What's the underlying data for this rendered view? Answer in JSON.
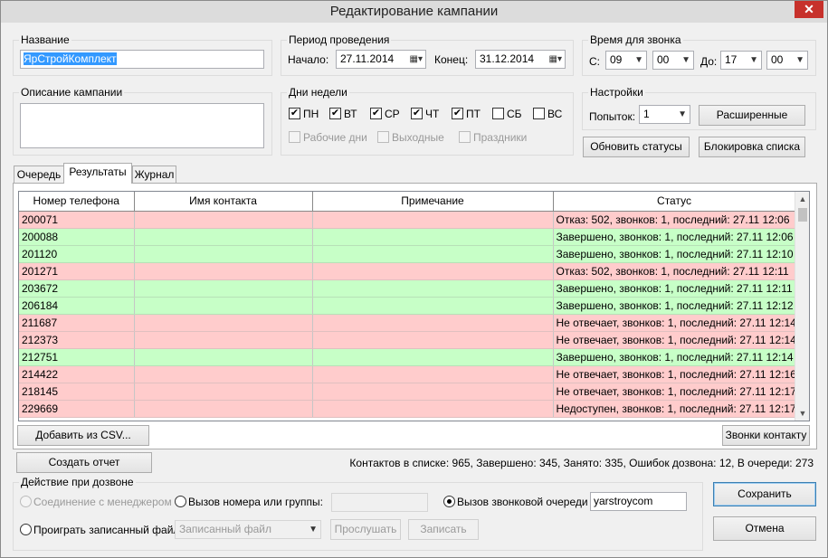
{
  "window": {
    "title": "Редактирование кампании",
    "close_glyph": "✕"
  },
  "name_group": {
    "label": "Название",
    "value": "ЯрСтройКомплект"
  },
  "desc_group": {
    "label": "Описание кампании",
    "value": ""
  },
  "period": {
    "label": "Период проведения",
    "start_label": "Начало:",
    "start_value": "27.11.2014",
    "end_label": "Конец:",
    "end_value": "31.12.2014"
  },
  "call_time": {
    "label": "Время для звонка",
    "from_label": "С:",
    "from_hour": "09",
    "from_min": "00",
    "to_label": "До:",
    "to_hour": "17",
    "to_min": "00"
  },
  "weekdays": {
    "label": "Дни недели",
    "days": [
      {
        "label": "ПН",
        "checked": true
      },
      {
        "label": "ВТ",
        "checked": true
      },
      {
        "label": "СР",
        "checked": true
      },
      {
        "label": "ЧТ",
        "checked": true
      },
      {
        "label": "ПТ",
        "checked": true
      },
      {
        "label": "СБ",
        "checked": false
      },
      {
        "label": "ВС",
        "checked": false
      }
    ],
    "workdays_label": "Рабочие дни",
    "weekends_label": "Выходные",
    "holidays_label": "Праздники"
  },
  "settings": {
    "label": "Настройки",
    "attempts_label": "Попыток:",
    "attempts_value": "1",
    "advanced_button": "Расширенные"
  },
  "buttons": {
    "update_statuses": "Обновить статусы",
    "block_list": "Блокировка списка",
    "add_csv": "Добавить из CSV...",
    "contact_calls": "Звонки контакту",
    "create_report": "Создать отчет",
    "save": "Сохранить",
    "cancel": "Отмена"
  },
  "tabs": [
    {
      "label": "Очередь",
      "active": false
    },
    {
      "label": "Результаты",
      "active": true
    },
    {
      "label": "Журнал",
      "active": false
    }
  ],
  "results_table": {
    "columns": [
      "Номер телефона",
      "Имя контакта",
      "Примечание",
      "Статус"
    ],
    "rows": [
      {
        "phone": "200071",
        "name": "",
        "note": "",
        "status": "Отказ: 502, звонков: 1, последний: 27.11 12:06",
        "state": "fail"
      },
      {
        "phone": "200088",
        "name": "",
        "note": "",
        "status": "Завершено, звонков: 1, последний: 27.11 12:06",
        "state": "ok"
      },
      {
        "phone": "201120",
        "name": "",
        "note": "",
        "status": "Завершено, звонков: 1, последний: 27.11 12:10",
        "state": "ok"
      },
      {
        "phone": "201271",
        "name": "",
        "note": "",
        "status": "Отказ: 502, звонков: 1, последний: 27.11 12:11",
        "state": "fail"
      },
      {
        "phone": "203672",
        "name": "",
        "note": "",
        "status": "Завершено, звонков: 1, последний: 27.11 12:11",
        "state": "ok"
      },
      {
        "phone": "206184",
        "name": "",
        "note": "",
        "status": "Завершено, звонков: 1, последний: 27.11 12:12",
        "state": "ok"
      },
      {
        "phone": "211687",
        "name": "",
        "note": "",
        "status": "Не отвечает, звонков: 1, последний: 27.11 12:14",
        "state": "fail"
      },
      {
        "phone": "212373",
        "name": "",
        "note": "",
        "status": "Не отвечает, звонков: 1, последний: 27.11 12:14",
        "state": "fail"
      },
      {
        "phone": "212751",
        "name": "",
        "note": "",
        "status": "Завершено, звонков: 1, последний: 27.11 12:14",
        "state": "ok"
      },
      {
        "phone": "214422",
        "name": "",
        "note": "",
        "status": "Не отвечает, звонков: 1, последний: 27.11 12:16",
        "state": "fail"
      },
      {
        "phone": "218145",
        "name": "",
        "note": "",
        "status": "Не отвечает, звонков: 1, последний: 27.11 12:17",
        "state": "fail"
      },
      {
        "phone": "229669",
        "name": "",
        "note": "",
        "status": "Недоступен, звонков: 1, последний: 27.11 12:17",
        "state": "fail"
      }
    ]
  },
  "stats": "Контактов в списке: 965, Завершено: 345, Занято: 335, Ошибок дозвона: 12, В очереди: 273",
  "dial_action": {
    "label": "Действие при дозвоне",
    "manager_connect": "Соединение с менеджером",
    "call_number": "Вызов номера или группы:",
    "call_number_value": "",
    "call_queue": "Вызов звонковой очереди",
    "queue_value": "yarstroycom",
    "play_file": "Проиграть записанный файл",
    "file_select": "Записанный файл",
    "listen_button": "Прослушать",
    "record_button": "Записать"
  },
  "colors": {
    "fail_row": "#ffcccc",
    "ok_row": "#c7ffc7",
    "selection": "#3399ff"
  },
  "icons": {
    "calendar": "calendar-icon",
    "dropdown": "chevron-down-icon",
    "close": "close-icon"
  }
}
